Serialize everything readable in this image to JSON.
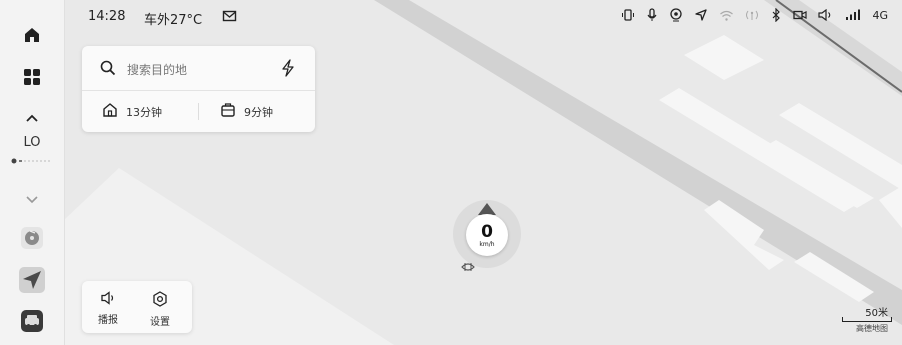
{
  "status": {
    "time": "14:28",
    "outside_temp": "车外27°C",
    "network": "4G",
    "icons": [
      "mail-icon",
      "phone-link-icon",
      "mic-icon",
      "location-icon",
      "navigation-icon",
      "wifi-icon",
      "hotspot-icon",
      "bluetooth-icon",
      "recording-icon",
      "volume-icon",
      "signal-icon"
    ]
  },
  "sidebar": {
    "items": [
      "home-icon",
      "apps-grid-icon",
      "chevron-up-icon",
      "chevron-down-icon",
      "music-app-icon",
      "navigation-app-icon",
      "car-app-icon"
    ],
    "climate_label": "LO"
  },
  "search": {
    "placeholder": "搜索目的地",
    "home_eta": "13分钟",
    "work_eta": "9分钟"
  },
  "bottom_card": {
    "broadcast_label": "播报",
    "settings_label": "设置"
  },
  "speedometer": {
    "value": "0",
    "unit": "km/h"
  },
  "map": {
    "scale_label": "50米",
    "provider": "高德地图"
  },
  "colors": {
    "map_bg": "#e9e9e9",
    "road": "#c8c8c8",
    "building": "#f6f6f6",
    "accent": "#555555"
  }
}
